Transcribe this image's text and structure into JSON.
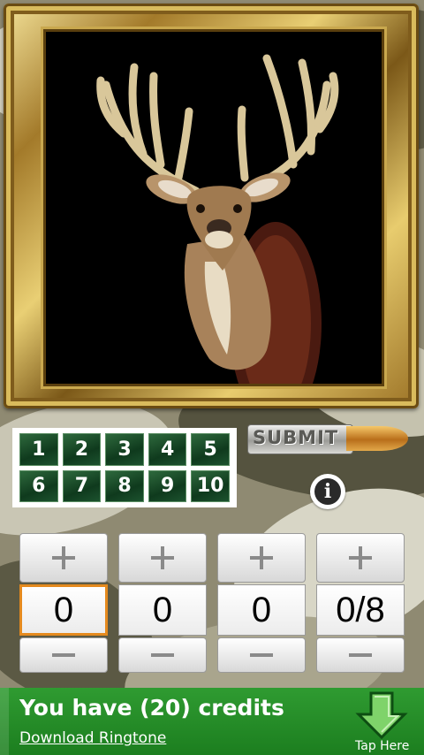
{
  "numbers": [
    "1",
    "2",
    "3",
    "4",
    "5",
    "6",
    "7",
    "8",
    "9",
    "10"
  ],
  "submit_label": "SUBMIT",
  "info_label": "i",
  "steppers": [
    {
      "value": "0",
      "focused": true
    },
    {
      "value": "0",
      "focused": false
    },
    {
      "value": "0",
      "focused": false
    },
    {
      "value": "0/8",
      "focused": false
    }
  ],
  "banner": {
    "headline": "You have (20) credits",
    "link": "Download Ringtone",
    "tap": "Tap Here"
  },
  "icons": {
    "picture": "deer-trophy-mount",
    "increment": "plus-icon",
    "decrement": "minus-icon",
    "info": "info-icon",
    "tap": "down-arrow-icon"
  }
}
